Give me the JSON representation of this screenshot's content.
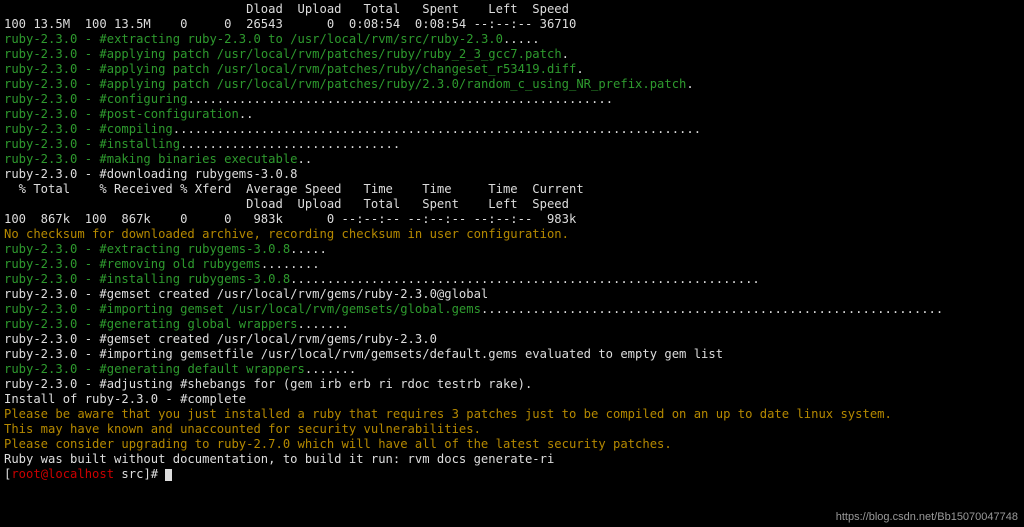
{
  "header_progress": "                                 Dload  Upload   Total   Spent    Left  Speed",
  "progress_line": "100 13.5M  100 13.5M    0     0  26543      0  0:08:54  0:08:54 --:--:-- 36710",
  "extract_prefix": "ruby-2.3.0 - ",
  "extract_action": "#extracting ruby-2.3.0 to /usr/local/rvm/src/ruby-2.3.0",
  "extract_dots": ".....",
  "patch1_action": "#applying patch /usr/local/rvm/patches/ruby/ruby_2_3_gcc7.patch",
  "patch1_dot": ".",
  "patch2_action": "#applying patch /usr/local/rvm/patches/ruby/changeset_r53419.diff",
  "patch2_dot": ".",
  "patch3_action": "#applying patch /usr/local/rvm/patches/ruby/2.3.0/random_c_using_NR_prefix.patch",
  "patch3_dot": ".",
  "configuring": "#configuring",
  "configuring_dots": "..........................................................",
  "postconfig": "#post-configuration",
  "postconfig_dots": "..",
  "compiling": "#compiling",
  "compiling_dots": "........................................................................",
  "installing": "#installing",
  "installing_dots": "..............................",
  "mkbin": "#making binaries executable",
  "mkbin_dots": "..",
  "downloading": "ruby-2.3.0 - #downloading rubygems-3.0.8",
  "curl_header": "  % Total    % Received % Xferd  Average Speed   Time    Time     Time  Current",
  "curl_header2": "                                 Dload  Upload   Total   Spent    Left  Speed",
  "curl_line": "100  867k  100  867k    0     0   983k      0 --:--:-- --:--:-- --:--:--  983k",
  "nochecksum": "No checksum for downloaded archive, recording checksum in user configuration.",
  "extract_rg": "#extracting rubygems-3.0.8",
  "extract_rg_dots": ".....",
  "remove_rg": "#removing old rubygems",
  "remove_rg_dots": "........",
  "install_rg": "#installing rubygems-3.0.8",
  "install_rg_dots": "................................................................",
  "gemset_global": "ruby-2.3.0 - #gemset created /usr/local/rvm/gems/ruby-2.3.0@global",
  "import_gemset": "#importing gemset /usr/local/rvm/gemsets/global.gems",
  "import_dots": "...............................................................",
  "genwrap": "#generating global wrappers",
  "genwrap_dots": ".......",
  "gemset_local": "ruby-2.3.0 - #gemset created /usr/local/rvm/gems/ruby-2.3.0",
  "import_default": "ruby-2.3.0 - #importing gemsetfile /usr/local/rvm/gemsets/default.gems evaluated to empty gem list",
  "gendefault": "#generating default wrappers",
  "gendefault_dots": ".......",
  "adjusting": "ruby-2.3.0 - #adjusting #shebangs for (gem irb erb ri rdoc testrb rake).",
  "install_complete": "Install of ruby-2.3.0 - #complete ",
  "warn1": "Please be aware that you just installed a ruby that requires 3 patches just to be compiled on an up to date linux system.",
  "warn2": "This may have known and unaccounted for security vulnerabilities.",
  "warn3": "Please consider upgrading to ruby-2.7.0 which will have all of the latest security patches.",
  "docline": "Ruby was built without documentation, to build it run: rvm docs generate-ri",
  "prompt_open": "[",
  "prompt_user": "root@localhost",
  "prompt_path": " src",
  "prompt_close": "]# ",
  "watermark": "https://blog.csdn.net/Bb15070047748"
}
